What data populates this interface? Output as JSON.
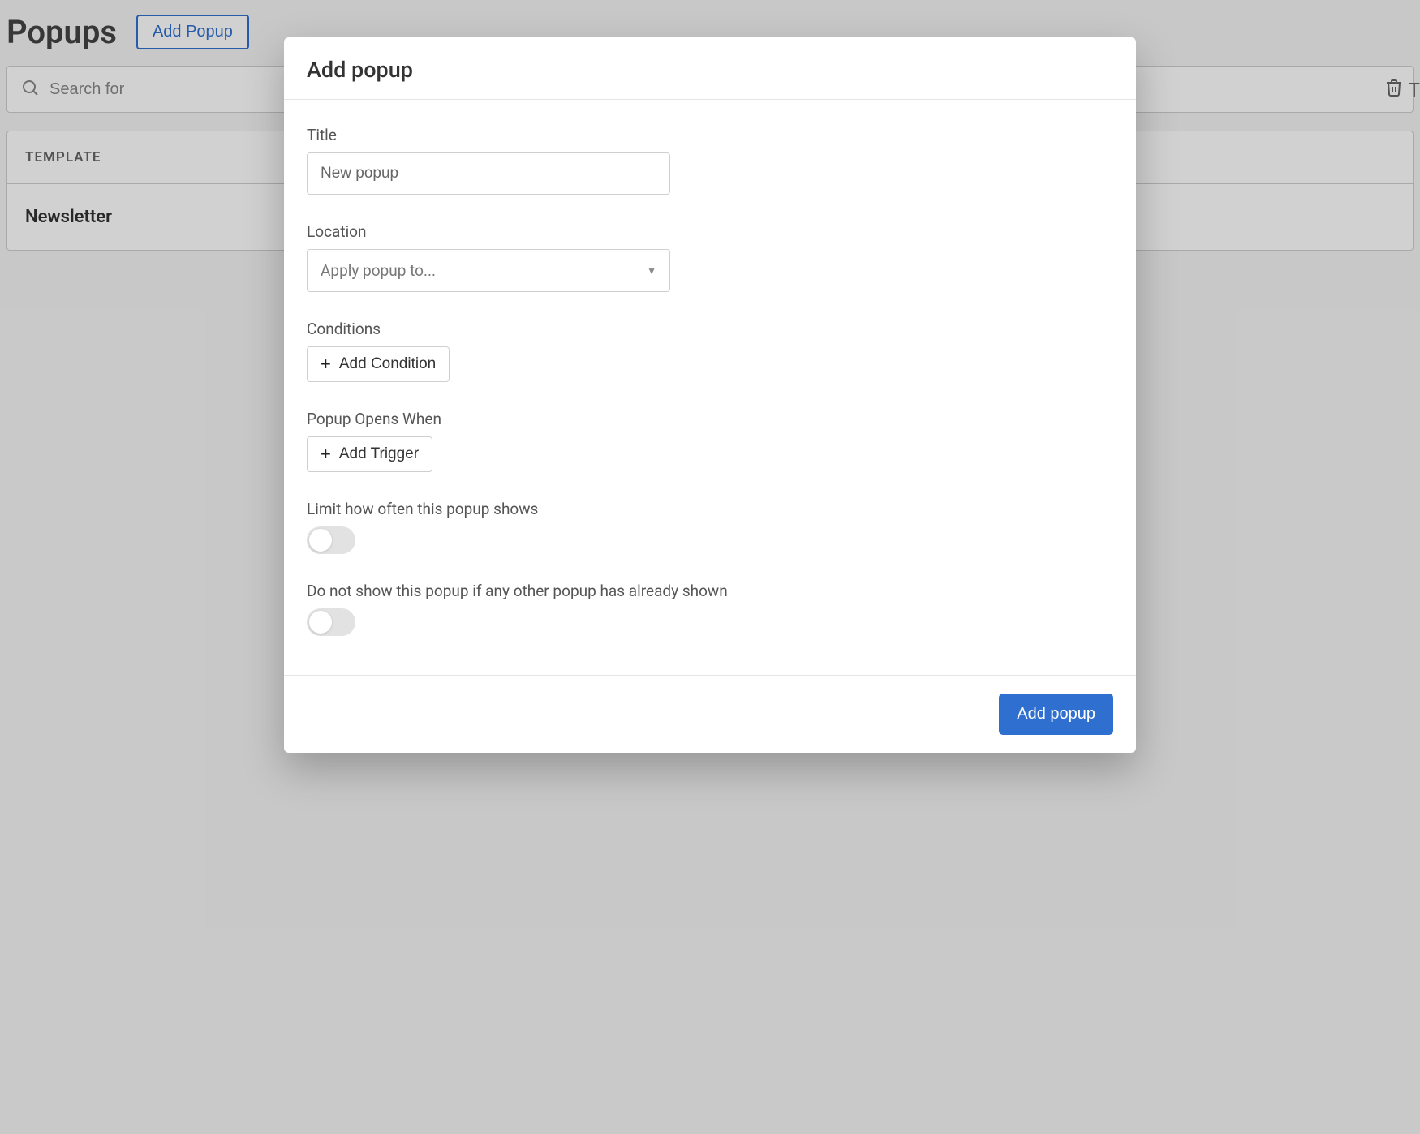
{
  "page": {
    "title": "Popups",
    "add_button": "Add Popup",
    "search_placeholder": "Search for",
    "table_header": "TEMPLATE",
    "row_name": "Newsletter"
  },
  "modal": {
    "title": "Add popup",
    "title_label": "Title",
    "title_value": "New popup",
    "location_label": "Location",
    "location_placeholder": "Apply popup to...",
    "conditions_label": "Conditions",
    "add_condition": "Add Condition",
    "popup_opens_label": "Popup Opens When",
    "add_trigger": "Add Trigger",
    "limit_label": "Limit how often this popup shows",
    "limit_on": false,
    "noshow_label": "Do not show this popup if any other popup has already shown",
    "noshow_on": false,
    "submit": "Add popup"
  }
}
